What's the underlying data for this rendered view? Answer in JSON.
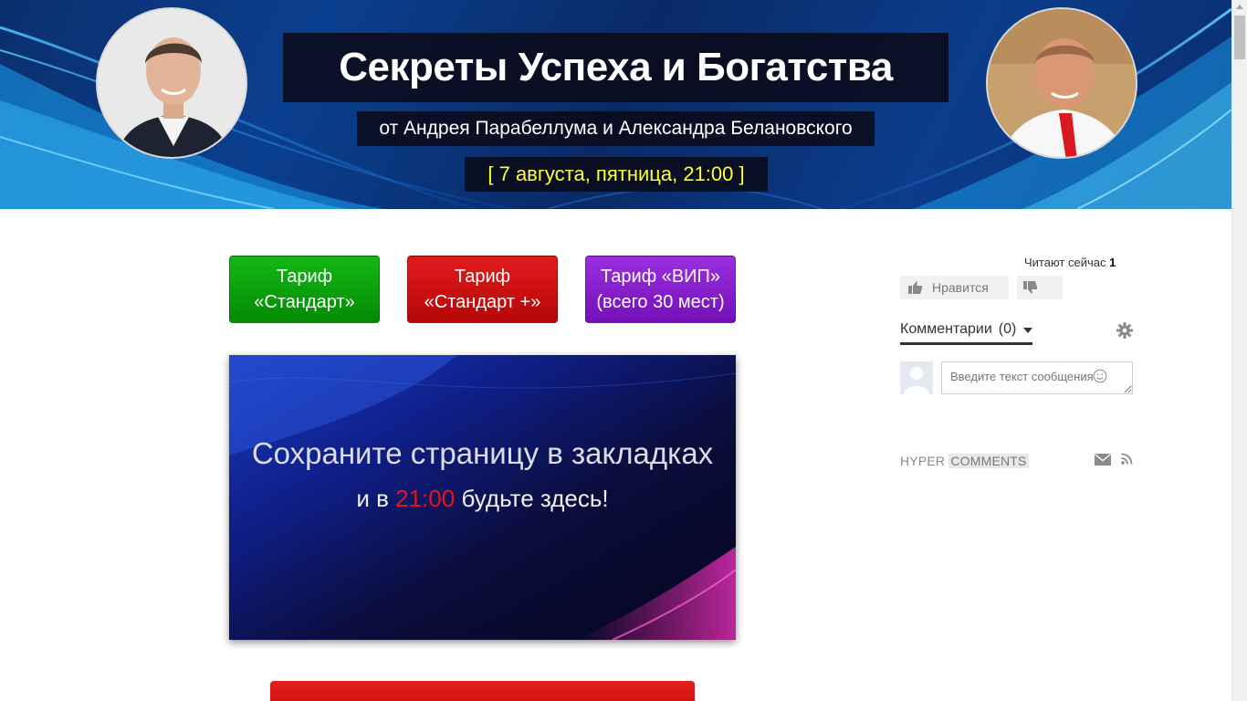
{
  "header": {
    "title": "Секреты Успеха и Богатства",
    "subtitle": "от Андрея Парабеллума и Александра Белановского",
    "date": "[ 7 августа, пятница, 21:00 ]"
  },
  "tariffs": [
    {
      "line1": "Тариф",
      "line2": "«Стандарт»",
      "color": "#0a9e0a"
    },
    {
      "line1": "Тариф",
      "line2": "«Стандарт +»",
      "color": "#c80f0f"
    },
    {
      "line1": "Тариф «ВИП»",
      "line2": "(всего 30 мест)",
      "color": "#8420cc"
    }
  ],
  "promo": {
    "line1": "Сохраните страницу в закладках",
    "line2_before": "и в ",
    "line2_time": "21:00",
    "line2_after": " будьте здесь!"
  },
  "comments_widget": {
    "readers_label": "Читают сейчас",
    "readers_count": "1",
    "like_label": "Нравится",
    "comments_tab_label": "Комментарии",
    "comments_count": "(0)",
    "message_placeholder": "Введите текст сообщения",
    "brand_hyper": "HYPER",
    "brand_comments": "COMMENTS"
  },
  "icons": {
    "like": "thumbs-up-icon",
    "dislike": "thumbs-down-icon",
    "settings": "gear-icon",
    "smile": "smile-icon",
    "mail": "mail-icon",
    "rss": "rss-icon"
  }
}
